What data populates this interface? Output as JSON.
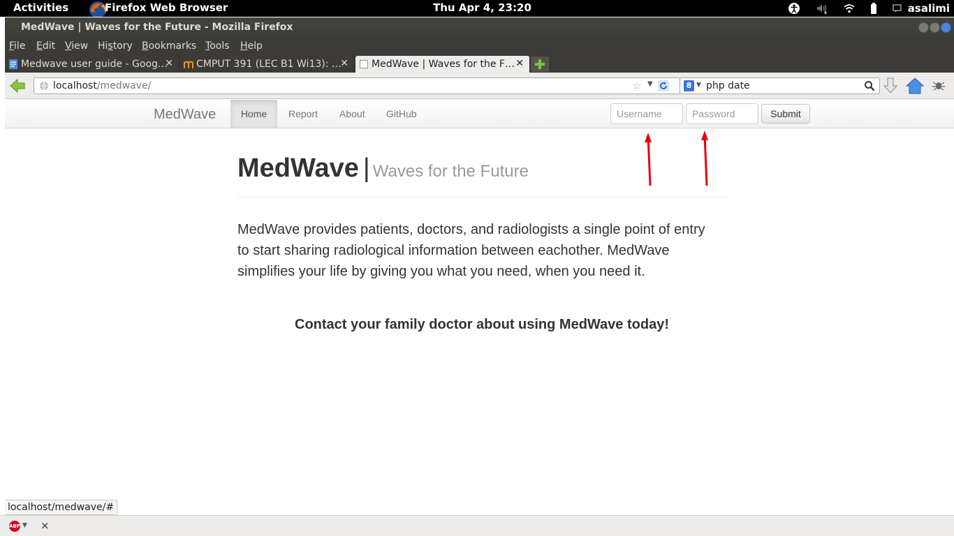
{
  "system_bar": {
    "activities": "Activities",
    "app_name": "Firefox Web Browser",
    "clock": "Thu Apr  4, 23:20",
    "user": "asalimi",
    "tray_icons": [
      "accessibility-icon",
      "volume-icon",
      "wifi-icon",
      "battery-icon",
      "chat-icon"
    ]
  },
  "window": {
    "title": "MedWave | Waves for the Future - Mozilla Firefox"
  },
  "menu": {
    "items": [
      {
        "accel": "F",
        "rest": "ile"
      },
      {
        "accel": "E",
        "rest": "dit"
      },
      {
        "accel": "V",
        "rest": "iew"
      },
      {
        "pre": "Hi",
        "accel": "s",
        "rest": "tory"
      },
      {
        "accel": "B",
        "rest": "ookmarks"
      },
      {
        "accel": "T",
        "rest": "ools"
      },
      {
        "accel": "H",
        "rest": "elp"
      }
    ]
  },
  "tabs": [
    {
      "label": "Medwave user guide - Goog…",
      "icon": "google-docs-icon"
    },
    {
      "label": "CMPUT 391 (LEC B1 Wi13): …",
      "icon": "moodle-icon"
    },
    {
      "label": "MedWave | Waves for the F…",
      "icon": "blank-page-icon",
      "active": true
    }
  ],
  "urlbar": {
    "host": "localhost",
    "path": "/medwave/"
  },
  "searchbar": {
    "engine": "8",
    "query": "php date"
  },
  "site_nav": {
    "brand": "MedWave",
    "links": [
      "Home",
      "Report",
      "About",
      "GitHub"
    ],
    "username_placeholder": "Username",
    "password_placeholder": "Password",
    "submit_label": "Submit"
  },
  "hero": {
    "title": "MedWave",
    "separator": "|",
    "subtitle": "Waves for the Future"
  },
  "lead_text": "MedWave provides patients, doctors, and radiologists a single point of entry to start sharing radiological information between eachother. MedWave simplifies your life by giving you what you need, when you need it.",
  "cta_text": "Contact your family doctor about using MedWave today!",
  "status_bar": {
    "url": "localhost/medwave/#"
  },
  "addon_bar": {
    "abp_label": "ABP",
    "close": "×"
  },
  "colors": {
    "annotation_arrow": "#e8000b",
    "nav_active_bg": "#e5e5e5"
  }
}
